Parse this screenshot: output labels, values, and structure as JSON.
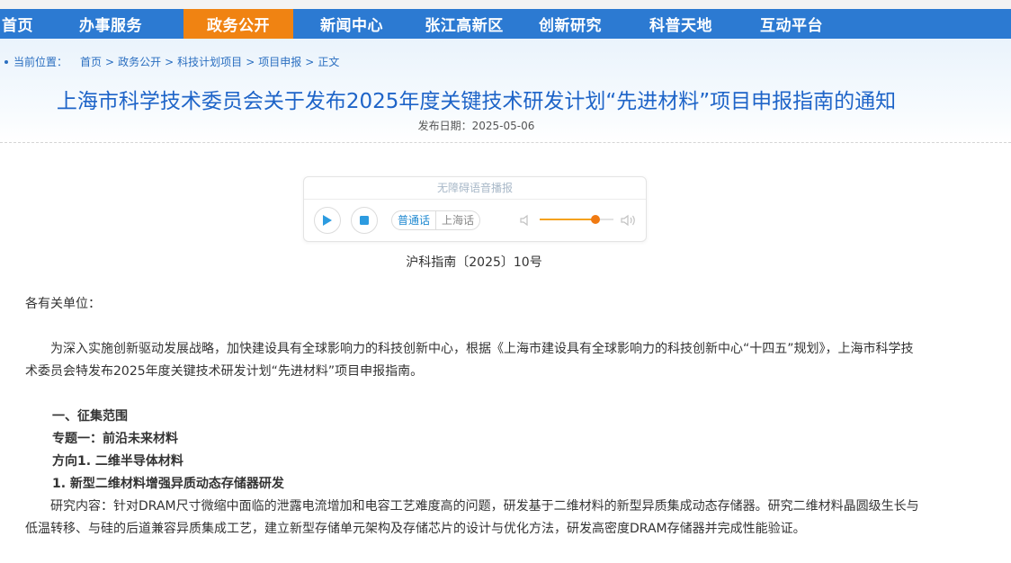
{
  "nav": {
    "items": [
      {
        "label": "首页",
        "active": false
      },
      {
        "label": "办事服务",
        "active": false
      },
      {
        "label": "政务公开",
        "active": true
      },
      {
        "label": "新闻中心",
        "active": false
      },
      {
        "label": "张江高新区",
        "active": false
      },
      {
        "label": "创新研究",
        "active": false
      },
      {
        "label": "科普天地",
        "active": false
      },
      {
        "label": "互动平台",
        "active": false
      }
    ]
  },
  "breadcrumb": {
    "label": "当前位置：",
    "items": [
      "首页",
      "政务公开",
      "科技计划项目",
      "项目申报",
      "正文"
    ],
    "sep": ">"
  },
  "article": {
    "title": "上海市科学技术委员会关于发布2025年度关键技术研发计划“先进材料”项目申报指南的通知",
    "date_label": "发布日期：",
    "date": "2025-05-06",
    "doc_no": "沪科指南〔2025〕10号",
    "greeting": "各有关单位：",
    "intro": "为深入实施创新驱动发展战略，加快建设具有全球影响力的科技创新中心，根据《上海市建设具有全球影响力的科技创新中心“十四五”规划》，上海市科学技术委员会特发布2025年度关键技术研发计划“先进材料”项目申报指南。",
    "s1": "一、征集范围",
    "s2": "专题一：前沿未来材料",
    "s3": "方向1. 二维半导体材料",
    "s4": "1. 新型二维材料增强异质动态存储器研发",
    "content": "研究内容：针对DRAM尺寸微缩中面临的泄露电流增加和电容工艺难度高的问题，研发基于二维材料的新型异质集成动态存储器。研究二维材料晶圆级生长与低温转移、与硅的后道兼容异质集成工艺，建立新型存储单元架构及存储芯片的设计与优化方法，研发高密度DRAM存储器并完成性能验证。"
  },
  "player": {
    "title": "无障碍语音播报",
    "dialects": [
      "普通话",
      "上海话"
    ],
    "volume": 0.75,
    "play_color": "#2c9be0",
    "accent": "#f07a12"
  }
}
